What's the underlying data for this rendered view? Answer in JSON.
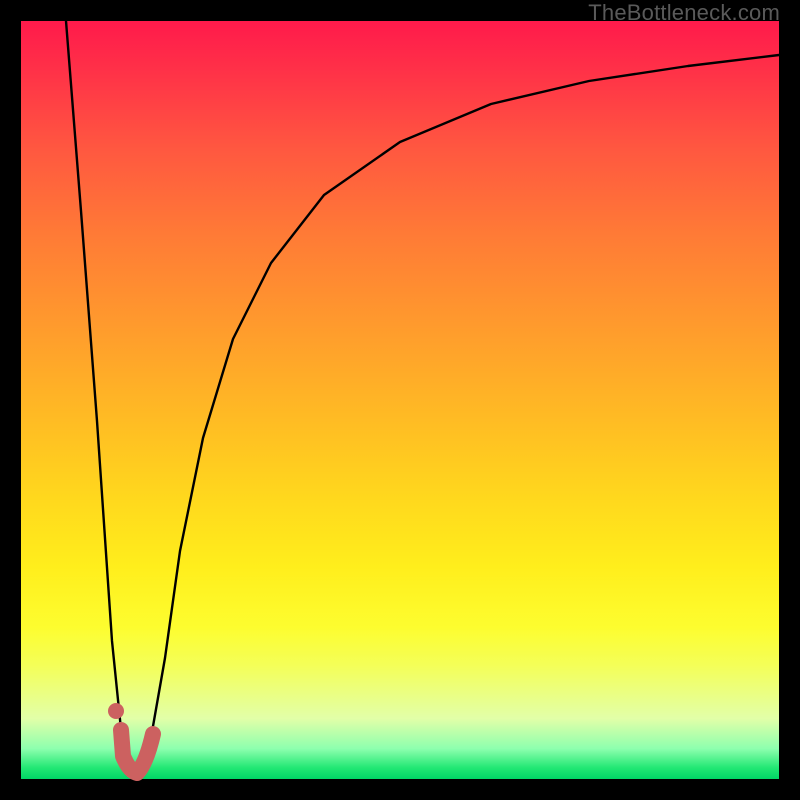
{
  "watermark": "TheBottleneck.com",
  "colors": {
    "background": "#000000",
    "curve_stroke": "#000000",
    "marker_stroke": "#cc6160"
  },
  "chart_data": {
    "type": "line",
    "title": "",
    "xlabel": "",
    "ylabel": "",
    "xlim": [
      0,
      100
    ],
    "ylim": [
      0,
      100
    ],
    "grid": false,
    "legend": false,
    "series": [
      {
        "name": "bottleneck-curve",
        "x": [
          6,
          8,
          10,
          12,
          13.5,
          15,
          17,
          19,
          21,
          24,
          28,
          33,
          40,
          50,
          62,
          75,
          88,
          100
        ],
        "y": [
          100,
          75,
          47,
          18,
          4,
          1,
          4,
          16,
          30,
          45,
          58,
          68,
          77,
          84,
          89,
          92,
          94,
          95.5
        ]
      }
    ],
    "markers": [
      {
        "name": "highlight-segment",
        "type": "path",
        "points": [
          {
            "x": 13.3,
            "y": 6.5
          },
          {
            "x": 13.5,
            "y": 3.0
          },
          {
            "x": 14.2,
            "y": 1.0
          },
          {
            "x": 15.3,
            "y": 0.8
          },
          {
            "x": 16.5,
            "y": 2.0
          },
          {
            "x": 17.4,
            "y": 6.0
          }
        ]
      },
      {
        "name": "highlight-dot",
        "type": "dot",
        "x": 12.5,
        "y": 9.0
      }
    ]
  }
}
